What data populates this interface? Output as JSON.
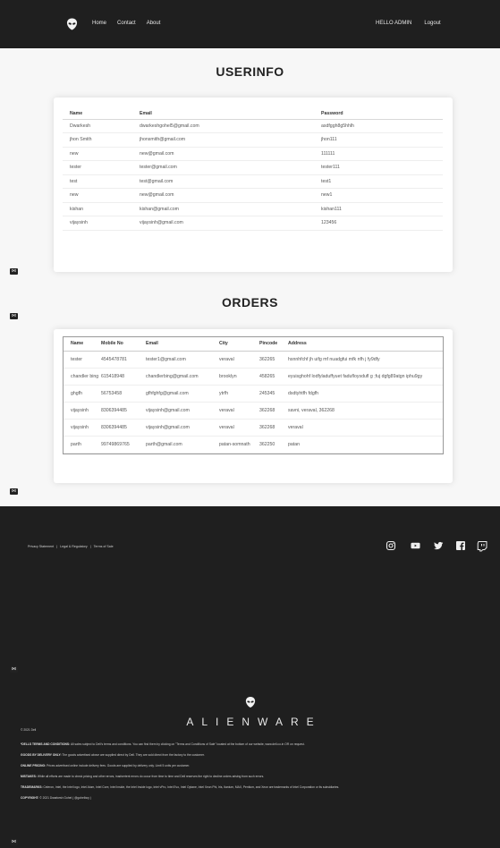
{
  "nav": {
    "home": "Home",
    "contact": "Contact",
    "about": "About",
    "greeting": "HELLO ADMIN",
    "logout": "Logout"
  },
  "userinfo": {
    "title": "USERINFO",
    "headers": [
      "Name",
      "Email",
      "Password"
    ],
    "rows": [
      [
        "Dwarkesh",
        "dwarkeshgohel5@gmail.com",
        "asdfggh8g5hhlh"
      ],
      [
        "jhon Smith",
        "jhonsmith@gmail.com",
        "jhon111"
      ],
      [
        "new",
        "new@gmail.com",
        "111111"
      ],
      [
        "tester",
        "tester@gmail.com",
        "tester111"
      ],
      [
        "test",
        "test@gmail.com",
        "test1"
      ],
      [
        "new",
        "new@gmail.com",
        "new1"
      ],
      [
        "kishan",
        "kishan@gmail.com",
        "kishan111"
      ],
      [
        "vijaysinh",
        "vijaysinh@gmail.com",
        "123456"
      ]
    ]
  },
  "orders": {
    "title": "ORDERS",
    "headers": [
      "Name",
      "Mobile No",
      "Email",
      "City",
      "Pincode",
      "Address"
    ],
    "rows": [
      [
        "tester",
        "4545478781",
        "tester1@gmail.com",
        "veraval",
        "362265",
        "hsnnhfchf jh uifg mf nuadgfui mfk nfh j fy9dfy"
      ],
      [
        "chandler bing",
        "615418948",
        "chandlerbing@gmail.com",
        "brooklyn",
        "458265",
        "eyuisghohf lodfyladuffyuet fadufloysdufl g ;fuj dgfg89atgn iphu9gy"
      ],
      [
        "ghgfh",
        "56753458",
        "gfhfghfg@gmail.com",
        "ytrfh",
        "245345",
        "dsdtyhtfh fdgfh"
      ],
      [
        "vijaysinh",
        "8306394485",
        "vijaysinh@gmail.com",
        "veraval",
        "362268",
        "savni, veraval, 362268"
      ],
      [
        "vijaysinh",
        "8306394485",
        "vijaysinh@gmail.com",
        "veraval",
        "362268",
        "veraval"
      ],
      [
        "parth",
        "99749869765",
        "parth@gmail.com",
        "patan-somnath",
        "362250",
        "patan"
      ]
    ]
  },
  "footer": {
    "links": [
      "Privacy Statement",
      "|",
      "Legal & Regulatory",
      "|",
      "Terms of Sale"
    ],
    "social_icons": [
      "instagram-icon",
      "youtube-icon",
      "twitter-icon",
      "facebook-icon",
      "twitch-icon"
    ],
    "brand": "ALIENWARE",
    "copyright_year": "© 2021 Dell",
    "legal": [
      {
        "label": "*DELLS TERMS AND CONDITIONS:",
        "text": "All sales subject to Dell's terms and conditions. You can find them by clicking on \"Terms and Conditions of Sale\" located at the bottom of our website, www.dell.co.in OR on request."
      },
      {
        "label": "GOODS BY DELIVERY ONLY:",
        "text": "The goods advertised above are supplied direct by Dell. They are sold direct from the factory to the customer."
      },
      {
        "label": "ONLINE PRICING:",
        "text": "Prices advertised online include delivery fees. Goods are supplied by delivery only. Limit 5 units per customer."
      },
      {
        "label": "MISTAKES:",
        "text": "While all efforts are made to check pricing and other errors, inadvertent errors do occur from time to time and Dell reserves the right to decline orders arising from such errors."
      },
      {
        "label": "TRADEMARKS:",
        "text": "Celeron, Intel, the Intel logo, Intel Atom, Intel Core, Intel Inside, the Intel Inside logo, Intel vPro, Intel Evo, Intel Optane, Intel Xeon Phi, Iris, Itanium, MAX, Pentium, and Xeon are trademarks of Intel Corporation or its subsidiaries."
      },
      {
        "label": "COPYRIGHT:",
        "text": "© 2021 Dwarkesh Gohel ( @gohelboy )"
      }
    ]
  }
}
